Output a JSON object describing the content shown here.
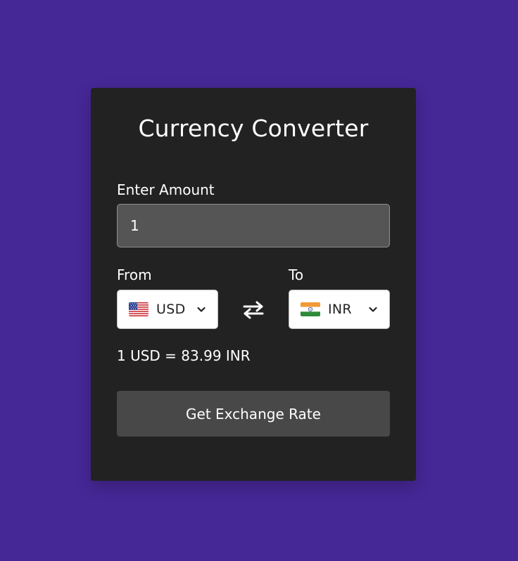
{
  "converter": {
    "title": "Currency Converter",
    "amount_label": "Enter Amount",
    "amount_value": "1",
    "from_label": "From",
    "to_label": "To",
    "from_currency": "USD",
    "to_currency": "INR",
    "from_flag": "us-flag-icon",
    "to_flag": "india-flag-icon",
    "swap_icon": "swap-arrows-icon",
    "result_text": "1 USD = 83.99 INR",
    "button_label": "Get Exchange Rate"
  },
  "colors": {
    "page_background": "#462796",
    "card_background": "#222222",
    "input_background": "#555555",
    "button_background": "#484848",
    "text": "#ffffff"
  }
}
